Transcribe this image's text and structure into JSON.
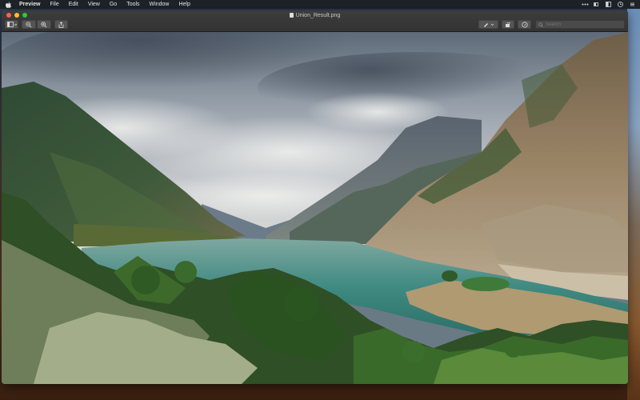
{
  "menubar": {
    "app_name": "Preview",
    "items": [
      "File",
      "Edit",
      "View",
      "Go",
      "Tools",
      "Window",
      "Help"
    ]
  },
  "window": {
    "title": "Union_Result.png",
    "search_placeholder": "Search"
  },
  "photo": {
    "subject": "mountain lake landscape"
  }
}
